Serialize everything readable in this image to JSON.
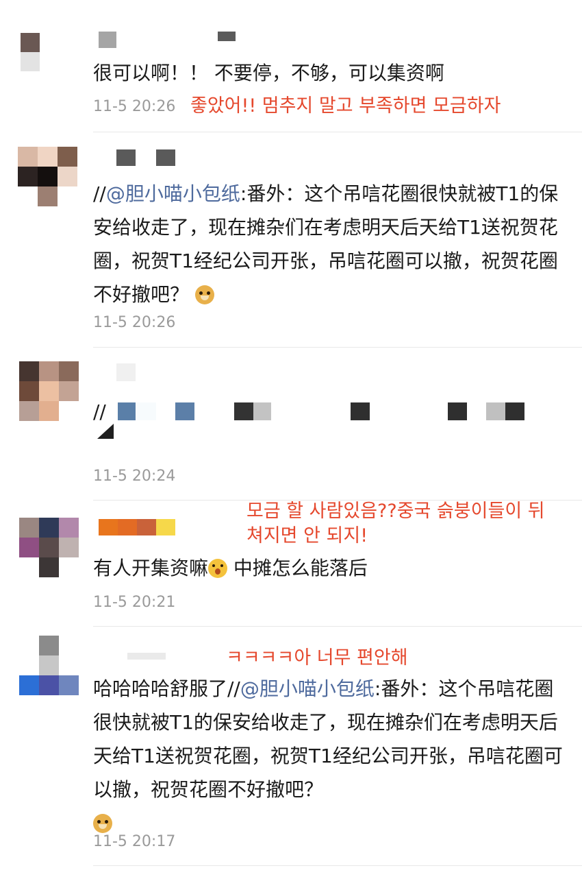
{
  "comments": [
    {
      "text": "很可以啊！！ 不要停，不够，可以集资啊",
      "timestamp": "11-5 20:26",
      "note": "좋았어!! 멈추지 말고 부족하면 모금하자",
      "avatar_colors": [
        "#6a5853",
        "#ffffff",
        "#e3e3e3",
        "#ffffff"
      ],
      "name_colors": [
        "#a5a5a5",
        "#5b5b5b"
      ]
    },
    {
      "prefix": "//",
      "mention": "@胆小喵小包纸",
      "text": ":番外：这个吊唁花圈很快就被T1的保安给收走了，现在摊杂们在考虑明天后天给T1送祝贺花圈，祝贺T1经纪公司开张，吊唁花圈可以撤，祝贺花圈不好撤吧？",
      "emoji": "doge-emoji",
      "timestamp": "11-5 20:26",
      "avatar_colors": [
        "#d9b8a5",
        "#f0d5c4",
        "#7e5e4c",
        "#2c2322",
        "#140f0e",
        "#ecd6c8",
        "#ffffff",
        "#9c7f72",
        "#ffffff"
      ],
      "name_colors": [
        "#5a5a5a",
        "#5a5a5a"
      ]
    },
    {
      "prefix": "//",
      "timestamp": "11-5 20:24",
      "avatar_colors": [
        "#463530",
        "#b89383",
        "#8a6a5b",
        "#6e4a3a",
        "#ecc0a2",
        "#c3a394",
        "#b79f96",
        "#e2af8f",
        "#ffffff"
      ],
      "name_colors": [
        "#f0f0f0"
      ],
      "redacted_colors": [
        "#5a7fa8",
        "#f7fbfd",
        "#5c7fa8",
        "#333333",
        "#c3c3c3",
        "#2f2f2f",
        "#2f2f2f",
        "#c0c0c0",
        "#2f2f2f",
        "#1f1f1f"
      ]
    },
    {
      "text": "有人开集资嘛",
      "emoji": "shocked-emoji",
      "text_after": " 中摊怎么能落后",
      "timestamp": "11-5 20:21",
      "note": "모금 할 사람있음??중국 슭붕이들이 뒤쳐지면 안 되지!",
      "avatar_colors": [
        "#9a8782",
        "#2f3a58",
        "#b288ab",
        "#8f4f83",
        "#5a4b4b",
        "#bfb2b0",
        "#ffffff",
        "#3c3636",
        "#ffffff"
      ],
      "name_colors": [
        "#e8751d",
        "#e36b24",
        "#c9623a",
        "#f6d84a"
      ]
    },
    {
      "text": "哈哈哈哈舒服了//",
      "mention": "@胆小喵小包纸",
      "text_after": ":番外：这个吊唁花圈很快就被T1的保安给收走了，现在摊杂们在考虑明天后天给T1送祝贺花圈，祝贺T1经纪公司开张，吊唁花圈可以撤，祝贺花圈不好撤吧？",
      "emoji": "doge-emoji",
      "timestamp": "11-5 20:17",
      "note": "ㅋㅋㅋㅋ아 너무 편안해",
      "avatar_colors": [
        "#ffffff",
        "#8b8b8b",
        "#ffffff",
        "#ffffff",
        "#c7c7c7",
        "#ffffff",
        "#2c6fd6",
        "#4b52a6",
        "#6f86be"
      ],
      "name_colors": [
        "#dcdcdc"
      ]
    }
  ]
}
